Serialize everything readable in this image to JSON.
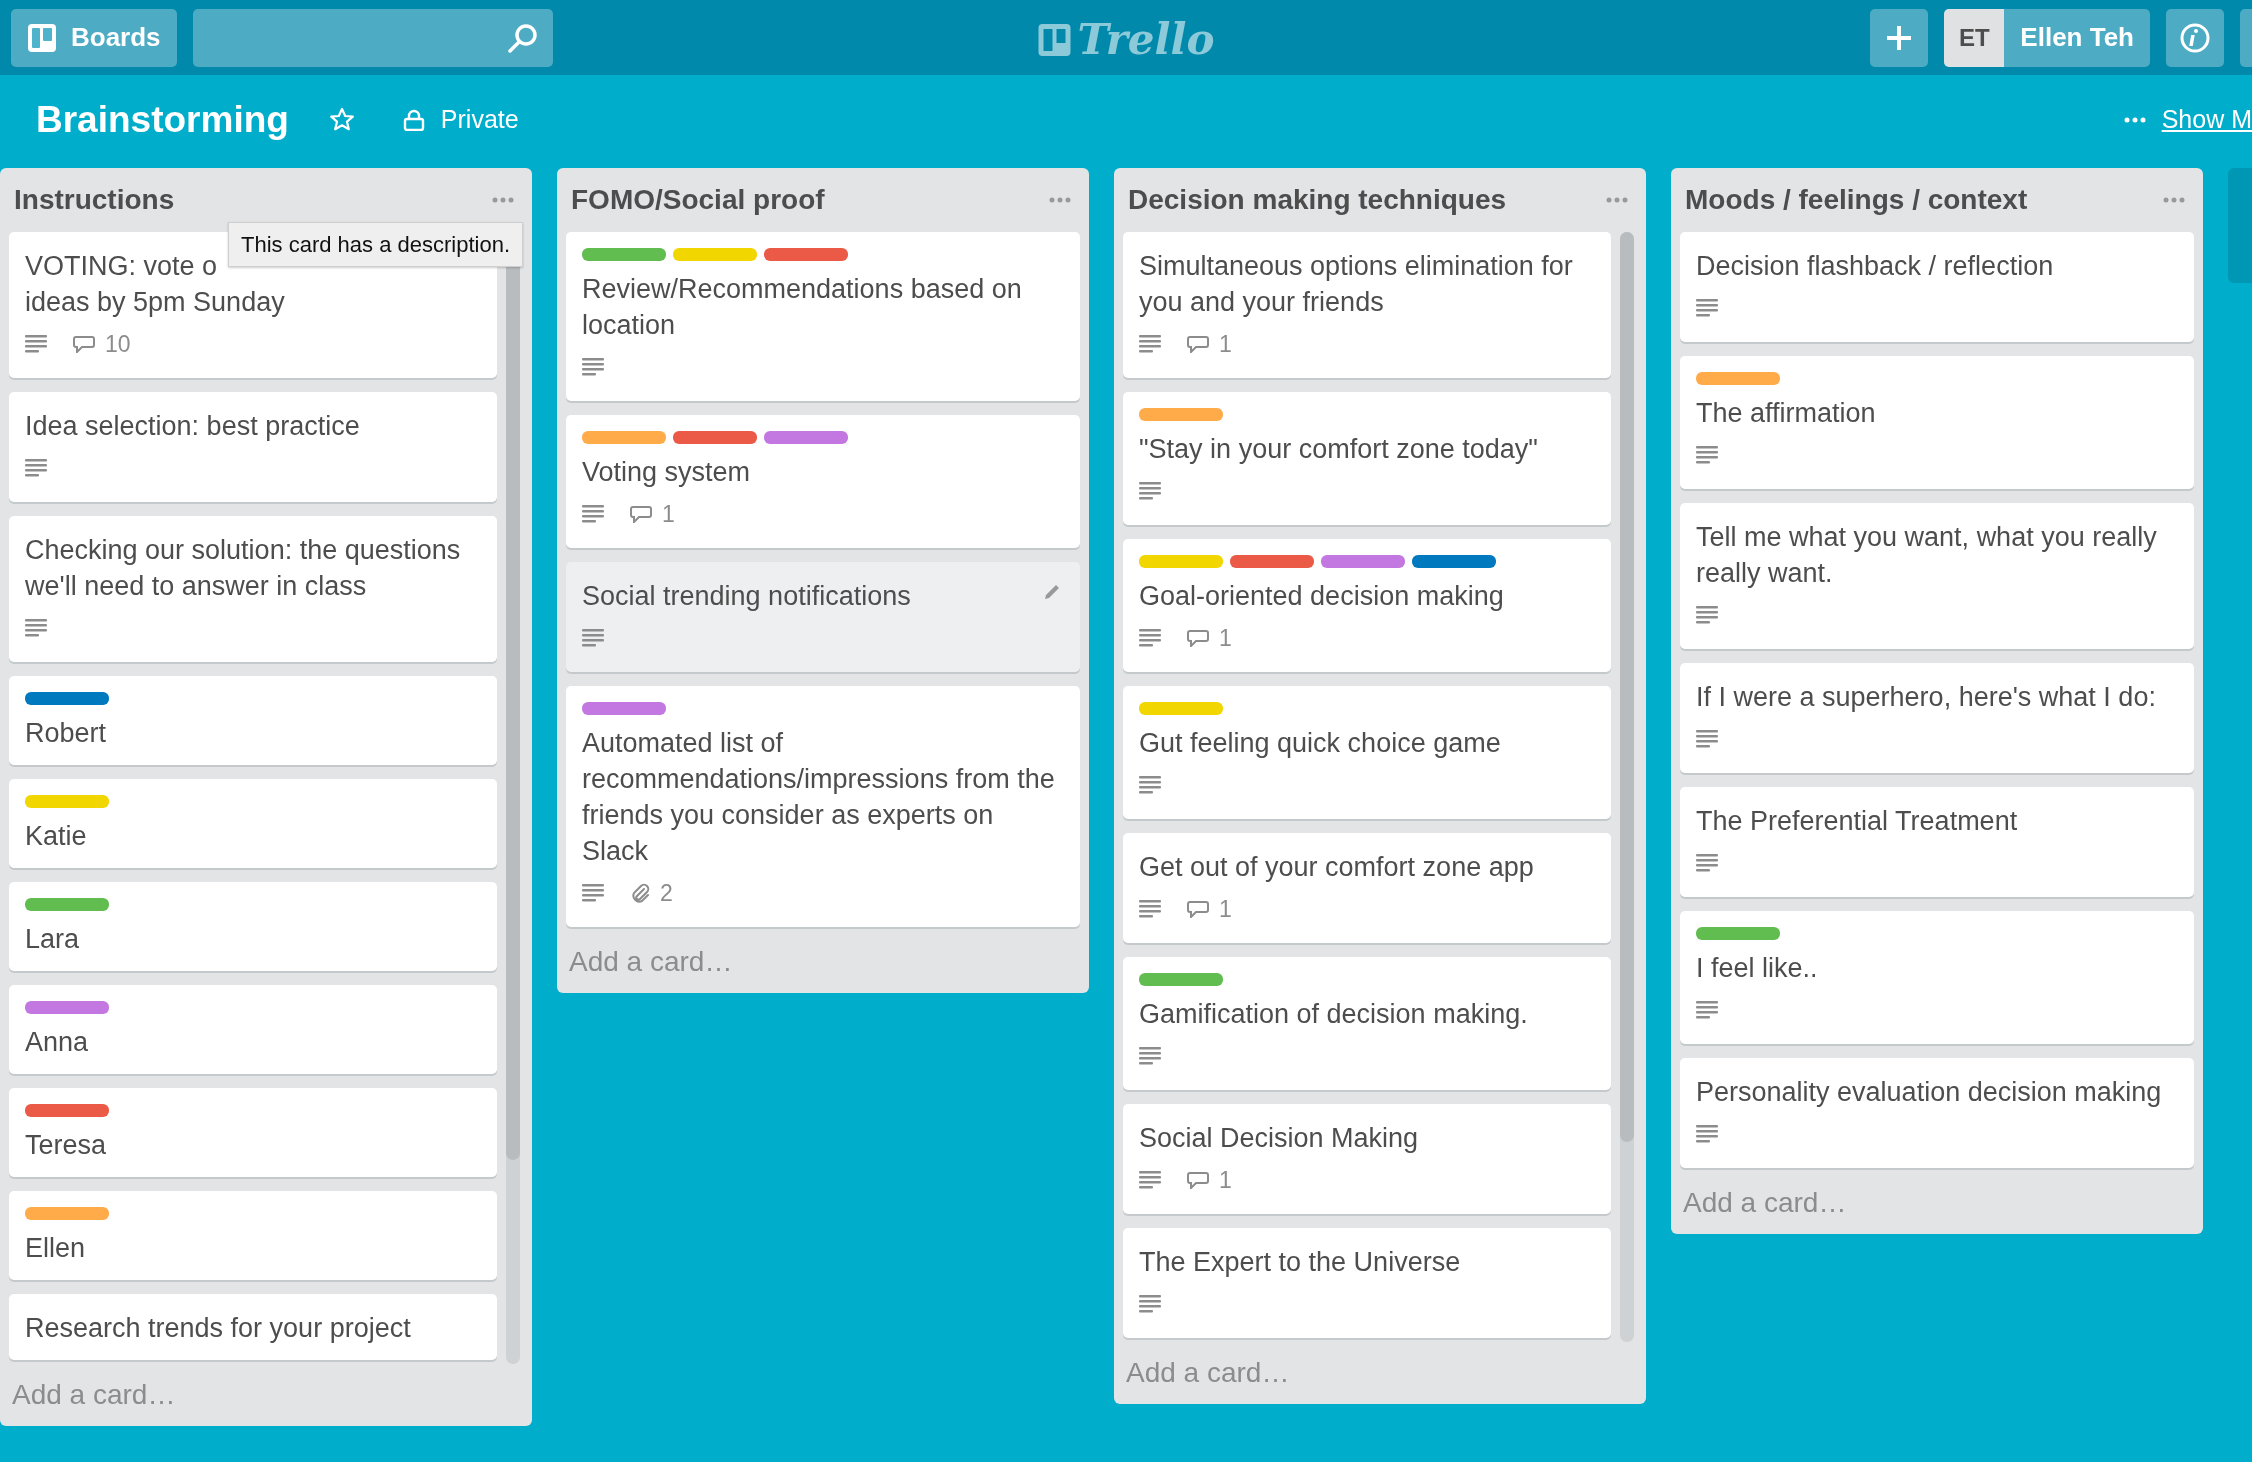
{
  "topbar": {
    "boards_button": "Boards",
    "logo": "Trello",
    "user": {
      "initials": "ET",
      "name": "Ellen Teh"
    }
  },
  "board": {
    "title": "Brainstorming",
    "visibility": "Private",
    "show_menu_link": "Show M"
  },
  "tooltip": {
    "text": "This card has a description."
  },
  "lists": [
    {
      "title": "Instructions",
      "scrollbar": true,
      "add_card": "Add a card…",
      "cards": [
        {
          "title": "VOTING: vote o\nideas by 5pm Sunday",
          "description": true,
          "comments": "10",
          "hovered": false
        },
        {
          "title": "Idea selection: best practice",
          "description": true,
          "hovered": false
        },
        {
          "title": "Checking our solution: the questions we'll need to answer in class",
          "description": true,
          "hovered": false
        },
        {
          "labels": [
            {
              "color": "#0079bf"
            }
          ],
          "title": "Robert",
          "description": false,
          "hovered": false
        },
        {
          "labels": [
            {
              "color": "#f2d600"
            }
          ],
          "title": "Katie",
          "description": false,
          "hovered": false
        },
        {
          "labels": [
            {
              "color": "#61bd4f"
            }
          ],
          "title": "Lara",
          "description": false,
          "hovered": false
        },
        {
          "labels": [
            {
              "color": "#c377e0"
            }
          ],
          "title": "Anna",
          "description": false,
          "hovered": false
        },
        {
          "labels": [
            {
              "color": "#eb5a46"
            }
          ],
          "title": "Teresa",
          "description": false,
          "hovered": false
        },
        {
          "labels": [
            {
              "color": "#ffab4a"
            }
          ],
          "title": "Ellen",
          "description": false,
          "hovered": false
        },
        {
          "title": "Research trends for your project",
          "description": false,
          "hovered": false
        }
      ]
    },
    {
      "title": "FOMO/Social proof",
      "scrollbar": false,
      "add_card": "Add a card…",
      "cards": [
        {
          "labels": [
            {
              "color": "#61bd4f"
            },
            {
              "color": "#f2d600"
            },
            {
              "color": "#eb5a46"
            }
          ],
          "title": "Review/Recommendations based on location",
          "description": true,
          "hovered": false
        },
        {
          "labels": [
            {
              "color": "#ffab4a"
            },
            {
              "color": "#eb5a46"
            },
            {
              "color": "#c377e0"
            }
          ],
          "title": "Voting system",
          "description": true,
          "comments": "1",
          "hovered": false
        },
        {
          "title": "Social trending notifications",
          "description": true,
          "hovered": true
        },
        {
          "labels": [
            {
              "color": "#c377e0"
            }
          ],
          "title": "Automated list of recommendations/impressions from the friends you consider as experts on Slack",
          "description": true,
          "attachments": "2",
          "hovered": false
        }
      ]
    },
    {
      "title": "Decision making techniques",
      "scrollbar": true,
      "add_card": "Add a card…",
      "cards": [
        {
          "title": "Simultaneous options elimination for you and your friends",
          "description": true,
          "comments": "1",
          "hovered": false
        },
        {
          "labels": [
            {
              "color": "#ffab4a"
            }
          ],
          "title": "\"Stay in your comfort zone today\"",
          "description": true,
          "hovered": false
        },
        {
          "labels": [
            {
              "color": "#f2d600"
            },
            {
              "color": "#eb5a46"
            },
            {
              "color": "#c377e0"
            },
            {
              "color": "#0079bf"
            }
          ],
          "title": "Goal-oriented decision making",
          "description": true,
          "comments": "1",
          "hovered": false
        },
        {
          "labels": [
            {
              "color": "#f2d600"
            }
          ],
          "title": "Gut feeling quick choice game",
          "description": true,
          "hovered": false
        },
        {
          "title": "Get out of your comfort zone app",
          "description": true,
          "comments": "1",
          "hovered": false
        },
        {
          "labels": [
            {
              "color": "#61bd4f"
            }
          ],
          "title": "Gamification of decision making.",
          "description": true,
          "hovered": false
        },
        {
          "title": "Social Decision Making",
          "description": true,
          "comments": "1",
          "hovered": false
        },
        {
          "title": "The Expert to the Universe",
          "description": true,
          "hovered": false
        }
      ]
    },
    {
      "title": "Moods / feelings / context",
      "scrollbar": false,
      "add_card": "Add a card…",
      "cards": [
        {
          "title": "Decision flashback / reflection",
          "description": true,
          "hovered": false
        },
        {
          "labels": [
            {
              "color": "#ffab4a"
            }
          ],
          "title": "The affirmation",
          "description": true,
          "hovered": false
        },
        {
          "title": "Tell me what you want, what you really really want.",
          "description": true,
          "hovered": false
        },
        {
          "title": "If I were a superhero, here's what I do:",
          "description": true,
          "hovered": false
        },
        {
          "title": "The Preferential Treatment",
          "description": true,
          "hovered": false
        },
        {
          "labels": [
            {
              "color": "#61bd4f"
            }
          ],
          "title": "I feel like..",
          "description": true,
          "hovered": false
        },
        {
          "title": "Personality evaluation decision making",
          "description": true,
          "hovered": false
        }
      ]
    }
  ]
}
